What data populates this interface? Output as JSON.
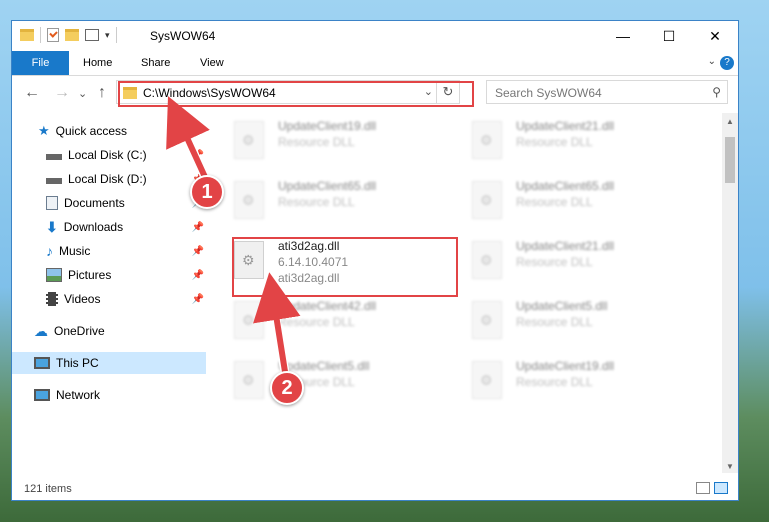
{
  "window": {
    "title": "SysWOW64",
    "controls": {
      "minimize": "—",
      "maximize": "☐",
      "close": "✕"
    },
    "quick_access_dropdown": "▾"
  },
  "ribbon": {
    "tabs": [
      "File",
      "Home",
      "Share",
      "View"
    ],
    "expand_glyph": "⌄",
    "help_glyph": "?"
  },
  "nav_buttons": {
    "back": "←",
    "forward": "→",
    "recent": "⌄",
    "up": "↑"
  },
  "address": {
    "path": "C:\\Windows\\SysWOW64",
    "dropdown": "⌄",
    "refresh": "↻"
  },
  "search": {
    "placeholder": "Search SysWOW64",
    "icon": "search-icon",
    "glyph": "⚲"
  },
  "sidebar": {
    "pin_glyph": "📌",
    "items": [
      {
        "label": "Quick access",
        "icon": "star-icon",
        "color": "#1979ca"
      },
      {
        "label": "Local Disk (C:)",
        "icon": "drive-icon"
      },
      {
        "label": "Local Disk (D:)",
        "icon": "drive-icon"
      },
      {
        "label": "Documents",
        "icon": "documents-icon"
      },
      {
        "label": "Downloads",
        "icon": "download-icon",
        "color": "#1979ca"
      },
      {
        "label": "Music",
        "icon": "music-icon",
        "color": "#1979ca"
      },
      {
        "label": "Pictures",
        "icon": "pictures-icon"
      },
      {
        "label": "Videos",
        "icon": "videos-icon"
      },
      {
        "label": "OneDrive",
        "icon": "cloud-icon",
        "color": "#1979ca"
      },
      {
        "label": "This PC",
        "icon": "computer-icon",
        "selected": true
      },
      {
        "label": "Network",
        "icon": "network-icon"
      }
    ]
  },
  "files": [
    {
      "name": "UpdateClient19.dll",
      "type": "Resource DLL"
    },
    {
      "name": "UpdateClient21.dll",
      "type": "Resource DLL"
    },
    {
      "name": "UpdateClient65.dll",
      "type": "Resource DLL"
    },
    {
      "name": "UpdateClient65.dll",
      "type": "Resource DLL"
    },
    {
      "name": "ati3d2ag.dll",
      "version": "6.14.10.4071",
      "desc": "ati3d2ag.dll",
      "highlighted": true
    },
    {
      "name": "UpdateClient21.dll",
      "type": "Resource DLL"
    },
    {
      "name": "UpdateClient42.dll",
      "type": "Resource DLL"
    },
    {
      "name": "UpdateClient5.dll",
      "type": "Resource DLL"
    },
    {
      "name": "UpdateClient5.dll",
      "type": "Resource DLL"
    },
    {
      "name": "UpdateClient19.dll",
      "type": "Resource DLL"
    }
  ],
  "scrollbar": {
    "up": "▲",
    "down": "▼"
  },
  "status": {
    "item_count": "121 items"
  },
  "markers": [
    "1",
    "2"
  ],
  "colors": {
    "accent": "#1979ca",
    "annotation_red": "#e24446"
  }
}
